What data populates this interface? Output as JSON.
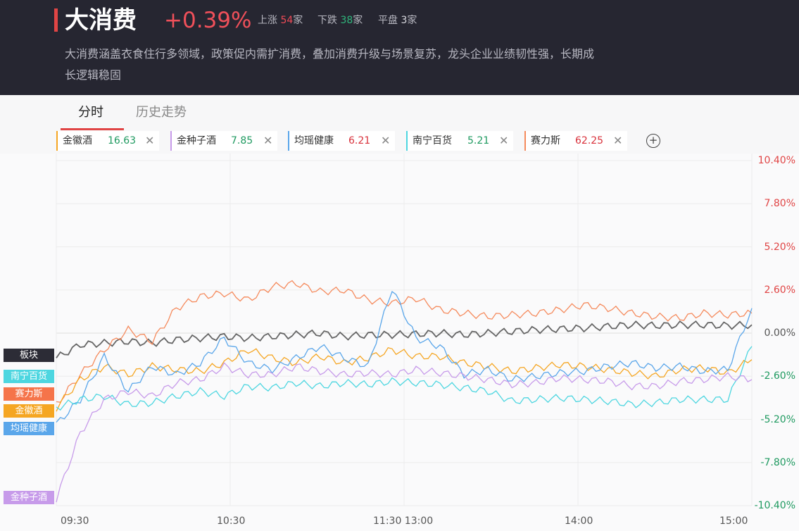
{
  "header": {
    "title": "大消费",
    "change": "+0.39%",
    "up_label": "上涨",
    "up_count": "54",
    "down_label": "下跌",
    "down_count": "38",
    "flat_label": "平盘",
    "flat_count": "3",
    "unit": "家",
    "description": "大消费涵盖衣食住行多领域，政策促内需扩消费，叠加消费升级与场景复苏，龙头企业业绩韧性强，长期成长逻辑稳固"
  },
  "tabs": [
    "分时",
    "历史走势"
  ],
  "active_tab": "分时",
  "stocks": [
    {
      "name": "金徽酒",
      "price": "16.63",
      "color": "#f5a623",
      "price_color": "green"
    },
    {
      "name": "金种子酒",
      "price": "7.85",
      "color": "#c79bea",
      "price_color": "green"
    },
    {
      "name": "均瑶健康",
      "price": "6.21",
      "color": "#5aa6ea",
      "price_color": "red"
    },
    {
      "name": "南宁百货",
      "price": "5.21",
      "color": "#4dd6e0",
      "price_color": "green"
    },
    {
      "name": "赛力斯",
      "price": "62.25",
      "color": "#f58a5c",
      "price_color": "red"
    }
  ],
  "legend": [
    {
      "label": "板块",
      "color": "#2c2c36"
    },
    {
      "label": "南宁百货",
      "color": "#4dd6e0"
    },
    {
      "label": "赛力斯",
      "color": "#f5744a"
    },
    {
      "label": "金徽酒",
      "color": "#f5a623"
    },
    {
      "label": "均瑶健康",
      "color": "#5aa6ea"
    },
    {
      "label": "金种子酒",
      "color": "#c79bea"
    }
  ],
  "chart_data": {
    "type": "line",
    "y_unit": "%",
    "ylim": [
      -10.4,
      10.4
    ],
    "y_ticks": [
      "10.40%",
      "7.80%",
      "5.20%",
      "2.60%",
      "0.00%",
      "-2.60%",
      "-5.20%",
      "-7.80%",
      "-10.40%"
    ],
    "x_ticks": [
      "09:30",
      "10:30",
      "11:30 13:00",
      "14:00",
      "15:00"
    ],
    "grid": true,
    "series": [
      {
        "name": "板块",
        "color": "#666666",
        "values": [
          -1.5,
          -0.7,
          -0.6,
          -0.5,
          -0.6,
          -0.4,
          -0.3,
          -0.2,
          -0.3,
          -0.2,
          -0.1,
          0.0,
          -0.2,
          -0.1,
          -0.1,
          -0.05,
          0.0,
          -0.1,
          0.0,
          0.1,
          0.2,
          0.25,
          0.3,
          0.4,
          0.5,
          0.45,
          0.5,
          0.5,
          0.45,
          0.5
        ]
      },
      {
        "name": "赛力斯",
        "color": "#f58a5c",
        "values": [
          -4.3,
          -2.5,
          -1.0,
          0.2,
          -0.5,
          1.5,
          2.2,
          2.4,
          2.0,
          2.8,
          3.0,
          2.5,
          2.6,
          2.0,
          1.8,
          2.1,
          1.4,
          1.2,
          1.0,
          1.1,
          1.2,
          1.4,
          1.7,
          1.5,
          1.2,
          1.0,
          0.9,
          1.2,
          1.1,
          1.2
        ]
      },
      {
        "name": "金徽酒",
        "color": "#f5a623",
        "values": [
          -4.5,
          -2.8,
          -2.0,
          -2.5,
          -2.0,
          -2.2,
          -2.3,
          -1.8,
          -1.0,
          -1.5,
          -1.8,
          -1.4,
          -1.8,
          -1.5,
          -1.0,
          -1.4,
          -1.4,
          -1.8,
          -2.0,
          -2.3,
          -2.1,
          -1.9,
          -2.0,
          -2.2,
          -2.4,
          -2.6,
          -2.2,
          -2.1,
          -2.4,
          -1.6
        ]
      },
      {
        "name": "均瑶健康",
        "color": "#5aa6ea",
        "values": [
          -5.5,
          -4.0,
          -1.4,
          -3.5,
          -2.0,
          -2.5,
          -1.8,
          -0.3,
          -1.8,
          -2.2,
          -1.5,
          -0.8,
          -1.5,
          -2.0,
          2.7,
          -0.3,
          -0.8,
          -2.5,
          -2.2,
          -2.8,
          -2.6,
          -2.4,
          -2.3,
          -2.0,
          -1.8,
          -2.1,
          -2.0,
          -2.3,
          -2.2,
          1.5
        ]
      },
      {
        "name": "南宁百货",
        "color": "#4dd6e0",
        "values": [
          -4.5,
          -4.0,
          -3.8,
          -4.3,
          -4.2,
          -3.8,
          -3.5,
          -3.8,
          -3.2,
          -3.3,
          -3.0,
          -3.2,
          -3.0,
          -3.1,
          -2.9,
          -3.0,
          -3.1,
          -3.3,
          -3.5,
          -4.1,
          -4.0,
          -3.9,
          -4.0,
          -4.1,
          -4.3,
          -4.2,
          -4.0,
          -4.0,
          -4.0,
          -0.8
        ]
      },
      {
        "name": "金种子酒",
        "color": "#c79bea",
        "values": [
          -10.0,
          -6.0,
          -4.0,
          -3.5,
          -3.8,
          -3.0,
          -2.8,
          -2.0,
          -2.5,
          -2.5,
          -2.0,
          -2.3,
          -2.5,
          -2.4,
          -2.5,
          -2.2,
          -2.4,
          -2.6,
          -2.8,
          -3.1,
          -3.0,
          -2.7,
          -2.8,
          -2.9,
          -3.2,
          -3.2,
          -2.9,
          -2.8,
          -2.6,
          -2.8
        ]
      }
    ]
  }
}
